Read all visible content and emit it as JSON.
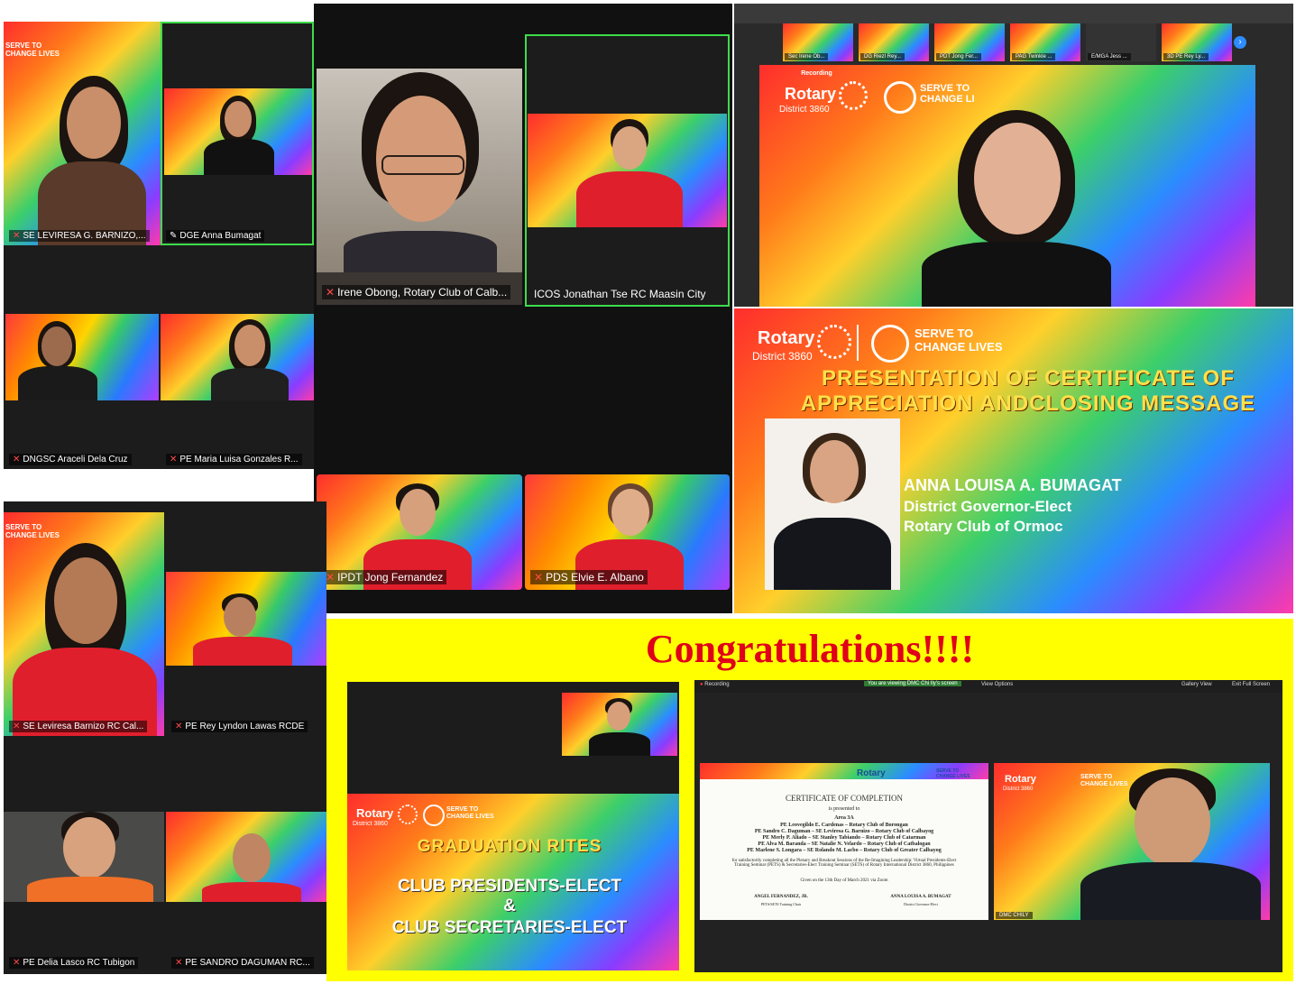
{
  "panel_a": {
    "top_left_slogan": "SERVE TO\nCHANGE LIVES",
    "tiles": [
      {
        "label": "SE LEVIRESA G. BARNIZO,..."
      },
      {
        "label": "DGE Anna Bumagat"
      },
      {
        "label": "DNGSC Araceli Dela Cruz"
      },
      {
        "label": "PE Maria Luisa Gonzales R..."
      }
    ]
  },
  "panel_b": {
    "tiles": [
      {
        "label": "Irene Obong, Rotary Club of Calb..."
      },
      {
        "label": "ICOS Jonathan Tse RC Maasin City"
      },
      {
        "label": "IPDT Jong Fernandez"
      },
      {
        "label": "PDS Elvie E. Albano"
      }
    ]
  },
  "panel_c": {
    "thumbs": [
      "Sec Irene Ob...",
      "DG Riezl Rey...",
      "PDT Jong Fer...",
      "PAG Twinkle ...",
      "E/MGA Jess ...",
      "3D PE Rey Ly..."
    ],
    "recording": "Recording",
    "rotary": "Rotary",
    "district": "District 3860",
    "slogan": "SERVE TO\nCHANGE LI"
  },
  "panel_d": {
    "rotary": "Rotary",
    "district": "District 3860",
    "slogan": "SERVE TO\nCHANGE LIVES",
    "title_line1": "PRESENTATION OF CERTIFICATE OF",
    "title_line2": "APPRECIATION ANDCLOSING MESSAGE",
    "speaker_name": "ANNA LOUISA A. BUMAGAT",
    "speaker_role": "District Governor-Elect",
    "speaker_club": "Rotary Club of Ormoc"
  },
  "panel_e": {
    "slogan": "SERVE TO\nCHANGE LIVES",
    "tiles": [
      {
        "label": "SE Leviresa Barnizo RC Cal..."
      },
      {
        "label": "PE Rey Lyndon Lawas RCDE"
      },
      {
        "label": "PE Delia Lasco RC Tubigon"
      },
      {
        "label": "PE SANDRO DAGUMAN RC..."
      }
    ]
  },
  "banner": {
    "text": "Congratulations!!!!",
    "bg_color": "#ffff00",
    "text_color": "#e0001a"
  },
  "panel_f": {
    "rotary": "Rotary",
    "district": "District 3860",
    "slogan": "SERVE TO\nCHANGE LIVES",
    "title": "GRADUATION RITES",
    "line1": "CLUB PRESIDENTS-ELECT",
    "amp": "&",
    "line2": "CLUB SECRETARIES-ELECT"
  },
  "panel_g": {
    "recording": "Recording",
    "viewing": "You are viewing DMC Chi Ily's screen",
    "view_options": "View Options",
    "gallery_view": "Gallery View",
    "exit_full": "Exit Full Screen",
    "cert_rotary": "Rotary",
    "cert_district": "District 3860",
    "cert_slogan": "SERVE TO\nCHANGE LIVES",
    "cert_title": "CERTIFICATE OF COMPLETION",
    "cert_presented": "is presented to",
    "cert_area": "Area 3A",
    "cert_names": [
      "PE Leovegildo E. Cardenas – Rotary Club of Borongan",
      "PE Sandro C. Daguman – SE Leviresa G. Barnizo – Rotary Club of Calbayog",
      "PE Merly P. Aliado – SE Stanley Tabiando – Rotary Club of Catarman",
      "PE Alva M. Baranda – SE Natalie N. Velardo – Rotary Club of Catbalogan",
      "PE Marlene S. Longara – SE Rolando M. Lacbo – Rotary Club of Greater Calbayog"
    ],
    "cert_body": "for satisfactorily completing all the Plenary and Breakout Sessions of the Re-Imagining Leadership: Virtual Presidents-Elect Training Seminar (PETS) & Secretaries-Elect Training Seminar (SETS) of Rotary International District 3860, Philippines",
    "cert_given": "Given on the 13th Day of March 2021 via Zoom",
    "sig1": "ANGEL FERNANDEZ, JR.",
    "sig1_role": "PETS/SETS Training Chair",
    "sig2": "ANNA LOUISA A. BUMAGAT",
    "sig2_role": "District Governor-Elect",
    "speaker_label": "DMC CHILY"
  }
}
